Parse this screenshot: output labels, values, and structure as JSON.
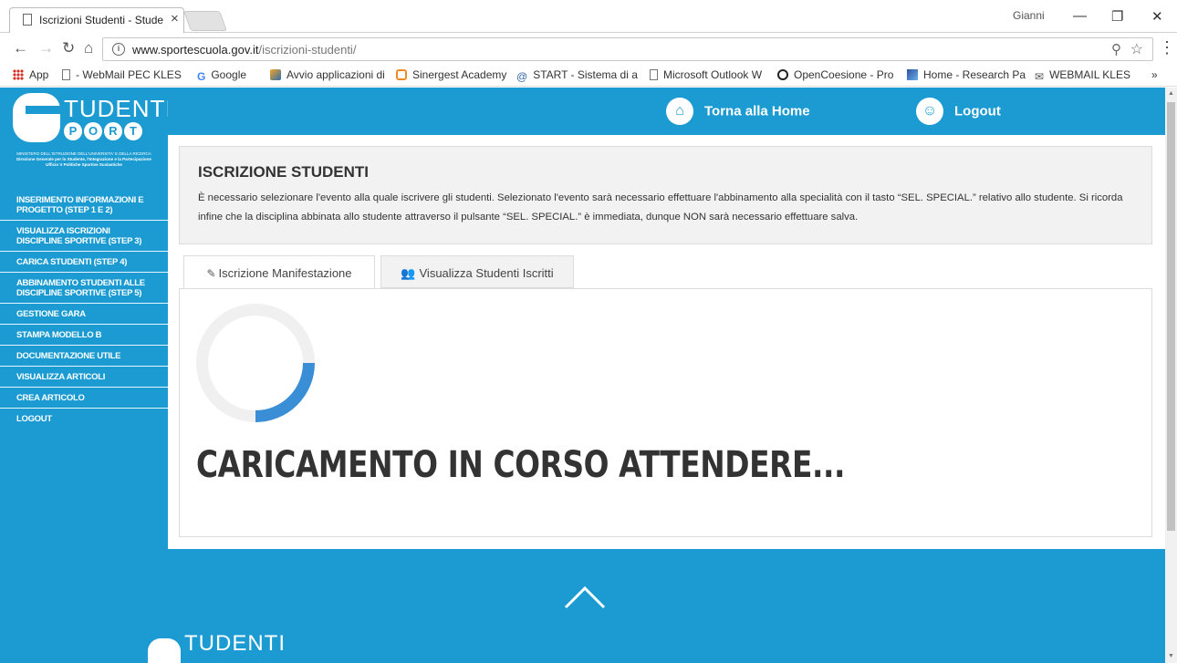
{
  "browser": {
    "tab_title": "Iscrizioni Studenti - Stude",
    "tab_close": "×",
    "profile_name": "Gianni",
    "url_domain": "www.sportescuola.gov.it",
    "url_path": "/iscrizioni-studenti/",
    "bookmarks": {
      "apps": "App",
      "b1": "- WebMail PEC KLES",
      "b2": "Google",
      "b3": "Avvio applicazioni di",
      "b4": "Sinergest Academy",
      "b5": "START - Sistema di a",
      "b6": "Microsoft Outlook W",
      "b7": "OpenCoesione - Pro",
      "b8": "Home - Research Pa",
      "b9": "WEBMAIL KLES",
      "more": "»"
    }
  },
  "logo": {
    "tudenti": "TUDENTI",
    "port_letters": [
      "P",
      "O",
      "R",
      "T"
    ],
    "ministry_line1": "MINISTERO DELL'ISTRUZIONE DELL'UNIVERSITA' E DELLA RICERCA",
    "ministry_line2": "Direzione Generale per lo Studente, l'Integrazione e la Partecipazione",
    "ministry_line3": "Ufficio V Politiche Sportive Scolastiche"
  },
  "sidebar": {
    "items": [
      "INSERIMENTO INFORMAZIONI E PROGETTO (STEP 1 E 2)",
      "VISUALIZZA ISCRIZIONI DISCIPLINE SPORTIVE (STEP 3)",
      "CARICA STUDENTI (STEP 4)",
      "ABBINAMENTO STUDENTI ALLE DISCIPLINE SPORTIVE (STEP 5)",
      "GESTIONE GARA",
      "STAMPA MODELLO B",
      "DOCUMENTAZIONE UTILE",
      "VISUALIZZA ARTICOLI",
      "CREA ARTICOLO",
      "LOGOUT"
    ]
  },
  "topbar": {
    "home_label": "Torna alla Home",
    "logout_label": "Logout"
  },
  "info": {
    "heading": "ISCRIZIONE STUDENTI",
    "description": "È necessario selezionare l'evento alla quale iscrivere gli studenti. Selezionato l'evento sarà necessario effettuare l'abbinamento alla specialità con il tasto “SEL. SPECIAL.” relativo allo studente. Si ricorda infine che la disciplina abbinata allo studente attraverso il pulsante “SEL. SPECIAL.” è immediata, dunque NON sarà necessario effettuare salva."
  },
  "tabs": {
    "tab1": "Iscrizione Manifestazione",
    "tab2": "Visualizza Studenti Iscritti"
  },
  "panel": {
    "loading_text": "CARICAMENTO IN CORSO ATTENDERE..."
  },
  "footer": {
    "logo_text": "TUDENTI"
  },
  "colors": {
    "brand_blue": "#1b9bd1",
    "spinner_arc": "#3a8ed6"
  }
}
